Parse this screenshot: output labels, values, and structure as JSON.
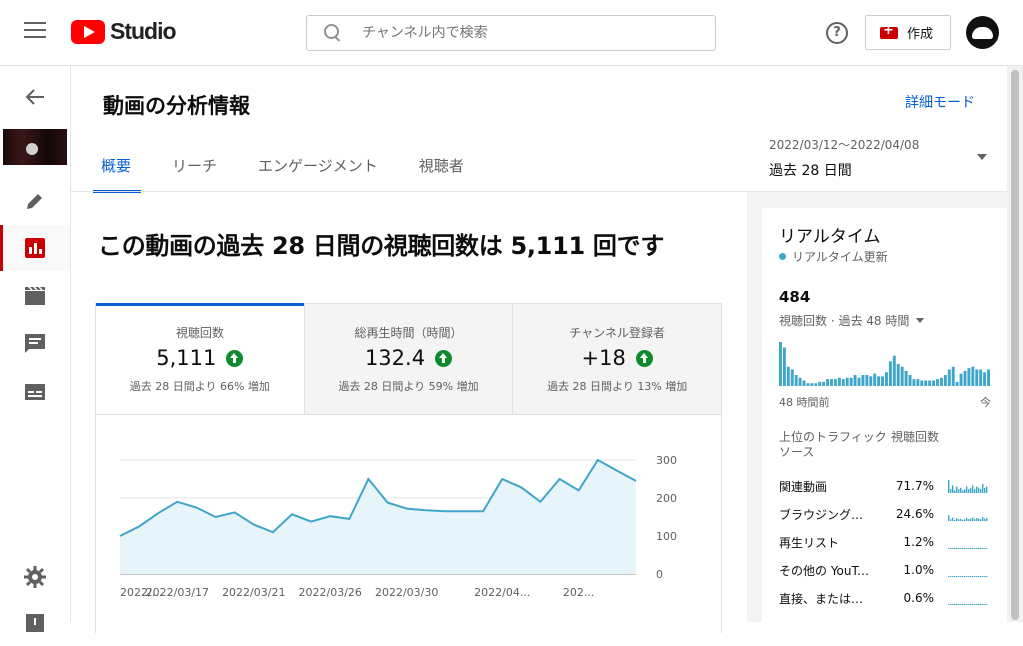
{
  "header": {
    "logo_text": "Studio",
    "search_placeholder": "チャンネル内で検索",
    "help_label": "?",
    "create_label": "作成"
  },
  "page": {
    "title": "動画の分析情報",
    "advanced_mode": "詳細モード",
    "tabs": [
      {
        "label": "概要",
        "active": true
      },
      {
        "label": "リーチ",
        "active": false
      },
      {
        "label": "エンゲージメント",
        "active": false
      },
      {
        "label": "視聴者",
        "active": false
      }
    ],
    "date_range": "2022/03/12～2022/04/08",
    "date_label": "過去 28 日間"
  },
  "overview": {
    "headline": "この動画の過去 28 日間の視聴回数は 5,111 回です",
    "metrics": [
      {
        "label": "視聴回数",
        "value": "5,111",
        "change": "過去 28 日間より 66% 増加"
      },
      {
        "label": "総再生時間（時間）",
        "value": "132.4",
        "change": "過去 28 日間より 59% 増加"
      },
      {
        "label": "チャンネル登録者",
        "value": "+18",
        "change": "過去 28 日間より 13% 増加"
      }
    ]
  },
  "chart_data": {
    "type": "area",
    "x_tick_labels": [
      "2022/...",
      "2022/03/17",
      "2022/03/21",
      "2022/03/26",
      "2022/03/30",
      "2022/04...",
      "202..."
    ],
    "values": [
      100,
      125,
      160,
      190,
      175,
      150,
      162,
      130,
      110,
      157,
      138,
      152,
      145,
      250,
      188,
      172,
      168,
      165,
      165,
      165,
      250,
      228,
      190,
      250,
      220,
      300,
      272,
      245
    ],
    "y_ticks": [
      0,
      100,
      200,
      300
    ],
    "ylim": [
      0,
      300
    ],
    "color": "#3ea6c9",
    "fill": "#e7f4f9"
  },
  "realtime": {
    "title": "リアルタイム",
    "live_label": "リアルタイム更新",
    "count": "484",
    "count_label": "視聴回数 · 過去 48 時間",
    "axis_left": "48 時間前",
    "axis_right": "今",
    "bar_values": [
      32,
      28,
      14,
      12,
      8,
      6,
      4,
      2,
      2,
      2,
      3,
      3,
      5,
      5,
      5,
      6,
      5,
      6,
      6,
      8,
      6,
      8,
      8,
      7,
      9,
      7,
      7,
      10,
      18,
      22,
      16,
      14,
      11,
      8,
      5,
      5,
      4,
      4,
      4,
      4,
      5,
      6,
      8,
      12,
      14,
      3,
      9,
      11,
      13,
      14,
      12,
      12,
      10,
      12
    ],
    "table_header_source": "上位のトラフィック ソース",
    "table_header_views": "視聴回数",
    "sources": [
      {
        "name": "関連動画",
        "pct": "71.7%",
        "level": 1.0
      },
      {
        "name": "ブラウジング…",
        "pct": "24.6%",
        "level": 0.45
      },
      {
        "name": "再生リスト",
        "pct": "1.2%",
        "level": 0.08
      },
      {
        "name": "その他の YouTu…",
        "pct": "1.0%",
        "level": 0.07
      },
      {
        "name": "直接、または不明",
        "pct": "0.6%",
        "level": 0.05
      }
    ]
  }
}
